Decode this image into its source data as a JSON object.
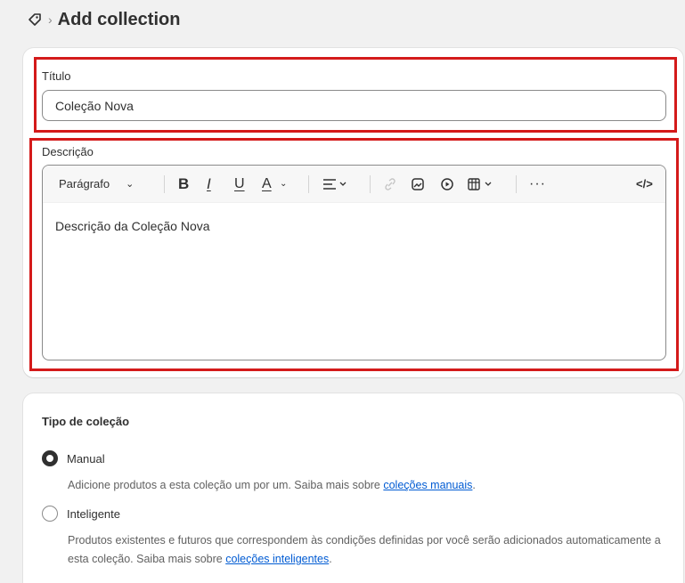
{
  "header": {
    "title": "Add collection",
    "icon": "tag-icon"
  },
  "titulo": {
    "label": "Título",
    "value": "Coleção Nova"
  },
  "descricao": {
    "label": "Descrição",
    "toolbar": {
      "paragraph": "Parágrafo",
      "bold": "B",
      "italic": "I",
      "underline": "U",
      "color": "A",
      "more": "···",
      "code": "</>"
    },
    "content": "Descrição da Coleção Nova"
  },
  "tipo": {
    "title": "Tipo de coleção",
    "manual": {
      "label": "Manual",
      "help": "Adicione produtos a esta coleção um por um. Saiba mais sobre ",
      "link": "coleções manuais",
      "end": "."
    },
    "inteligente": {
      "label": "Inteligente",
      "help": "Produtos existentes e futuros que correspondem às condições definidas por você serão adicionados automaticamente a esta coleção. Saiba mais sobre ",
      "link": "coleções inteligentes",
      "end": "."
    },
    "selected": "Manual"
  },
  "colors": {
    "highlight": "#d41a1a",
    "link": "#005bd3"
  }
}
